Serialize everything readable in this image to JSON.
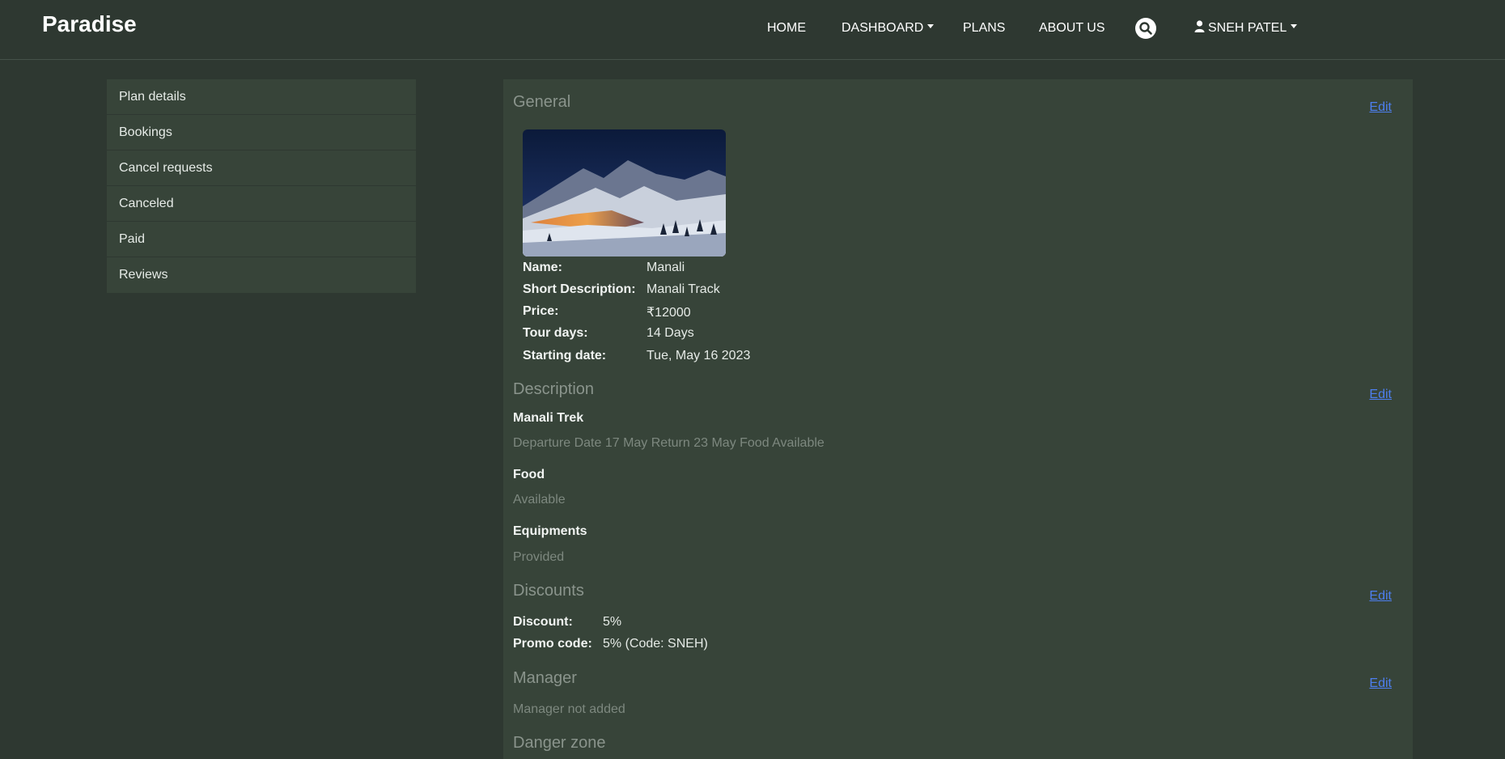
{
  "navbar": {
    "brand": "Paradise",
    "home": "HOME",
    "dashboard": "DASHBOARD",
    "plans": "PLANS",
    "about": "ABOUT US",
    "user": "SNEH PATEL"
  },
  "sidebar": {
    "items": [
      {
        "label": "Plan details"
      },
      {
        "label": "Bookings"
      },
      {
        "label": "Cancel requests"
      },
      {
        "label": "Canceled"
      },
      {
        "label": "Paid"
      },
      {
        "label": "Reviews"
      }
    ]
  },
  "general": {
    "title": "General",
    "edit": "Edit",
    "name_label": "Name:",
    "name": "Manali",
    "short_desc_label": "Short Description:",
    "short_desc": "Manali Track",
    "price_label": "Price:",
    "price": "₹12000",
    "tour_days_label": "Tour days:",
    "tour_days": "14 Days",
    "start_label": "Starting date:",
    "start": "Tue, May 16 2023"
  },
  "description": {
    "title": "Description",
    "edit": "Edit",
    "heading": "Manali Trek",
    "text": "Departure Date 17 May Return 23 May Food Available",
    "food_label": "Food",
    "food": "Available",
    "equip_label": "Equipments",
    "equip": "Provided"
  },
  "discounts": {
    "title": "Discounts",
    "edit": "Edit",
    "discount_label": "Discount:",
    "discount": "5%",
    "promo_label": "Promo code:",
    "promo": "5% (Code: SNEH)"
  },
  "manager": {
    "title": "Manager",
    "edit": "Edit",
    "text": "Manager not added"
  },
  "danger": {
    "title": "Danger zone"
  },
  "colors": {
    "background": "#2e3831",
    "panel": "#374439",
    "link": "#4d7ff0"
  }
}
